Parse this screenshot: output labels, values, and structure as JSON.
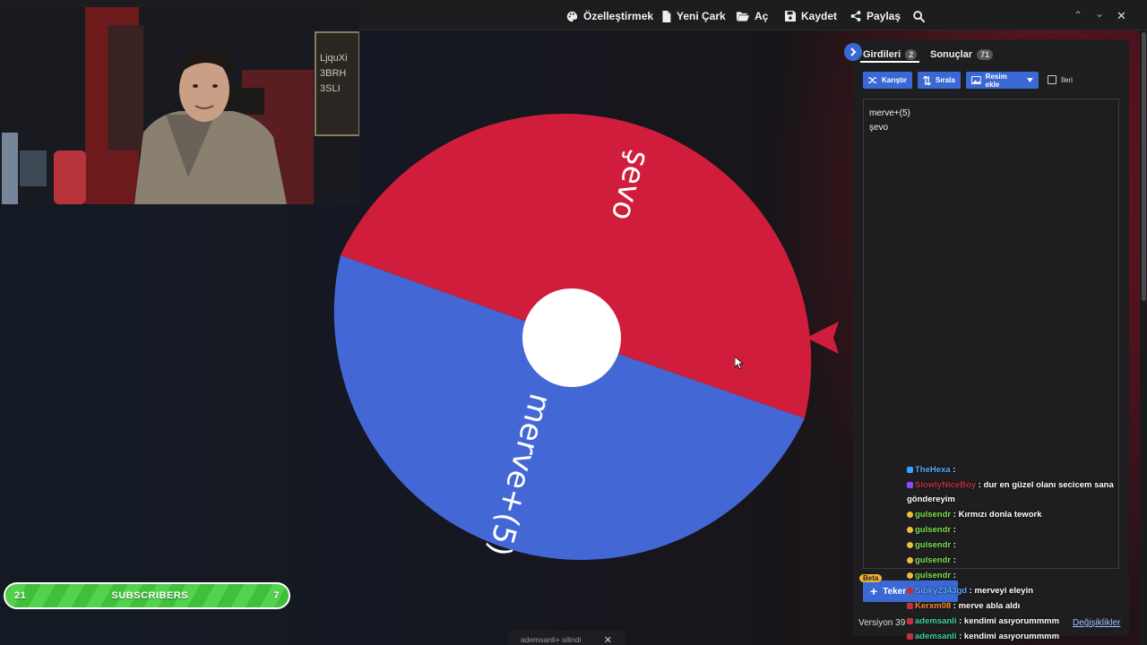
{
  "toolbar": {
    "customize": "Özelleştirmek",
    "new_wheel": "Yeni Çark",
    "open": "Aç",
    "save": "Kaydet",
    "share": "Paylaş"
  },
  "wheel": {
    "segments": [
      {
        "label": "şevo",
        "color": "#d11d3c"
      },
      {
        "label": "merve+(5)",
        "color": "#4467d6"
      }
    ],
    "pointer_color": "#d11d3c",
    "center_color": "#ffffff"
  },
  "panel": {
    "tabs": [
      {
        "label": "Girdileri",
        "count": "2"
      },
      {
        "label": "Sonuçlar",
        "count": "71"
      }
    ],
    "buttons": {
      "shuffle": "Karıştır",
      "sort": "Sırala",
      "add_image": "Resim ekle"
    },
    "advanced_label": "İleri",
    "entries": [
      "merve+(5)",
      "şevo"
    ],
    "add_wheel_label": "Teker",
    "beta": "Beta",
    "version": "Versiyon 39",
    "changelog": "Değişiklikler",
    "accent": "#3a69d6"
  },
  "chat": [
    {
      "user": "TheHexa",
      "color": "#5aa9ff",
      "message": ""
    },
    {
      "user": "SlowlyNiceBoy",
      "color": "#c23040",
      "message": "dur en güzel olanı secicem sana"
    },
    {
      "user": "",
      "color": "#ffffff",
      "message": "göndereyim"
    },
    {
      "user": "gulsendr",
      "color": "#7be04a",
      "message": "Kırmızı donla tework"
    },
    {
      "user": "gulsendr",
      "color": "#7be04a",
      "message": ""
    },
    {
      "user": "gulsendr",
      "color": "#7be04a",
      "message": ""
    },
    {
      "user": "gulsendr",
      "color": "#7be04a",
      "message": ""
    },
    {
      "user": "gulsendr",
      "color": "#7be04a",
      "message": ""
    },
    {
      "user": "Sibky2343gd",
      "color": "#5aa9ff",
      "message": "merveyi eleyin"
    },
    {
      "user": "Kerxm08",
      "color": "#ff8a2a",
      "message": "merve abla aldı"
    },
    {
      "user": "ademsanli",
      "color": "#3ad6a0",
      "message": "kendimi asıyorummmm"
    },
    {
      "user": "ademsanli",
      "color": "#3ad6a0",
      "message": "kendimi asıyorummmm"
    }
  ],
  "subscribers": {
    "current": "21",
    "label": "SUBSCRIBERS",
    "goal": "7"
  },
  "toast": {
    "message": "ademsanli+ silindi"
  }
}
